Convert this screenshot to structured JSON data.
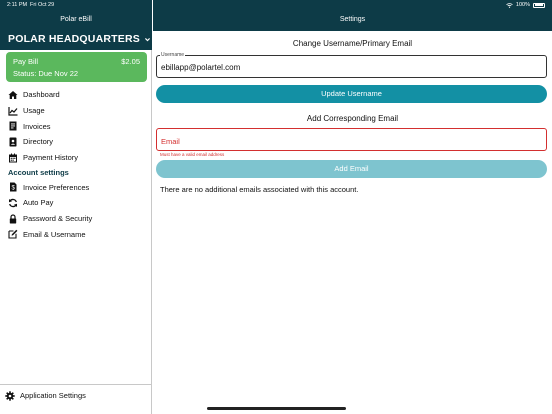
{
  "status_bar": {
    "time": "2:11 PM",
    "date": "Fri Oct 29",
    "battery": "100%"
  },
  "sidebar": {
    "title": "Polar eBill",
    "org_name": "POLAR HEADQUARTERS",
    "pay_bill": {
      "label": "Pay Bill",
      "amount": "$2.05",
      "status": "Status: Due Nov 22",
      "color": "#5bb85d"
    },
    "items": [
      {
        "label": "Dashboard",
        "icon": "home-icon"
      },
      {
        "label": "Usage",
        "icon": "chart-icon"
      },
      {
        "label": "Invoices",
        "icon": "invoice-icon"
      },
      {
        "label": "Directory",
        "icon": "contact-book-icon"
      },
      {
        "label": "Payment History",
        "icon": "calendar-icon"
      }
    ],
    "account_section": "Account settings",
    "account_items": [
      {
        "label": "Invoice Preferences",
        "icon": "invoice-settings-icon"
      },
      {
        "label": "Auto Pay",
        "icon": "refresh-icon"
      },
      {
        "label": "Password & Security",
        "icon": "lock-icon"
      },
      {
        "label": "Email & Username",
        "icon": "edit-icon"
      }
    ],
    "footer": {
      "label": "Application Settings",
      "icon": "gear-icon"
    }
  },
  "main": {
    "title": "Settings",
    "username_section": {
      "heading": "Change Username/Primary Email",
      "field_label": "Username",
      "field_value": "ebillapp@polartel.com",
      "button": "Update Username"
    },
    "email_section": {
      "heading": "Add Corresponding Email",
      "placeholder": "Email",
      "error": "Must have a valid email address",
      "button": "Add Email",
      "info": "There are no additional emails associated with this account."
    }
  },
  "colors": {
    "header": "#0d3b47",
    "accent": "#1390a4",
    "accent_disabled": "#7ec4cf",
    "error": "#d32f2f"
  }
}
